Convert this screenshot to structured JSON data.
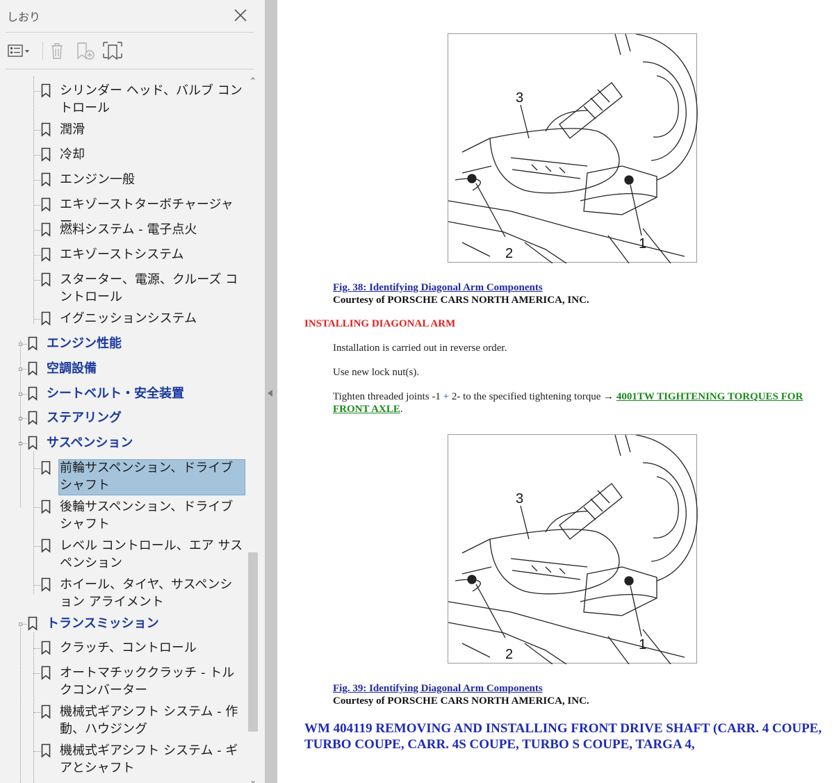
{
  "panel": {
    "title": "しおり",
    "toolbar": [
      "options-menu",
      "delete-bookmark",
      "new-bookmark",
      "bookmark-from-selection"
    ]
  },
  "bookmarks": [
    {
      "label": "シリンダー ヘッド、バルブ コントロール",
      "level": 2
    },
    {
      "label": "潤滑",
      "level": 2
    },
    {
      "label": "冷却",
      "level": 2
    },
    {
      "label": "エンジン一般",
      "level": 2
    },
    {
      "label": "エキゾーストターボチャージャー",
      "level": 2
    },
    {
      "label": "燃料システム - 電子点火",
      "level": 2
    },
    {
      "label": "エキゾーストシステム",
      "level": 2
    },
    {
      "label": "スターター、電源、クルーズ コントロール",
      "level": 2
    },
    {
      "label": "イグニッションシステム",
      "level": 2
    },
    {
      "label": "エンジン性能",
      "level": 1
    },
    {
      "label": "空調設備",
      "level": 1
    },
    {
      "label": "シートベルト・安全装置",
      "level": 1
    },
    {
      "label": "ステアリング",
      "level": 1
    },
    {
      "label": "サスペンション",
      "level": 1
    },
    {
      "label": "前輪サスペンション、ドライブ シャフト",
      "level": 2,
      "selected": true
    },
    {
      "label": "後輪サスペンション、ドライブ シャフト",
      "level": 2
    },
    {
      "label": "レベル コントロール、エア サスペンション",
      "level": 2
    },
    {
      "label": "ホイール、タイヤ、サスペンション アライメント",
      "level": 2
    },
    {
      "label": "トランスミッション",
      "level": 1
    },
    {
      "label": "クラッチ、コントロール",
      "level": 2
    },
    {
      "label": "オートマチッククラッチ - トルクコンバーター",
      "level": 2
    },
    {
      "label": "機械式ギアシフト システム - 作動、ハウジング",
      "level": 2
    },
    {
      "label": "機械式ギアシフト システム - ギアとシャフト",
      "level": 2
    }
  ],
  "document": {
    "figure_labels": [
      "3",
      "2",
      "1"
    ],
    "fig38_caption": "Fig. 38: Identifying Diagonal Arm Components",
    "fig38_courtesy": "Courtesy of PORSCHE CARS NORTH AMERICA, INC.",
    "section_heading": "INSTALLING DIAGONAL ARM",
    "para1": "Installation is carried out in reverse order.",
    "para2": "Use new lock nut(s).",
    "para3_prefix": "Tighten threaded joints -1 ",
    "para3_plus": "+",
    "para3_middle": " 2- to the specified tightening torque → ",
    "para3_link": "4001TW TIGHTENING TORQUES FOR FRONT AXLE",
    "para3_suffix": ".",
    "fig39_caption": "Fig. 39: Identifying Diagonal Arm Components",
    "fig39_courtesy": "Courtesy of PORSCHE CARS NORTH AMERICA, INC.",
    "wm_heading": "WM 404119 REMOVING AND INSTALLING FRONT DRIVE SHAFT (CARR. 4 COUPE, TURBO COUPE, CARR. 4S COUPE, TURBO S COUPE, TARGA 4,"
  },
  "colors": {
    "panel_bg": "#f2f2f2",
    "selection": "#a5c4dc",
    "level1_text": "#1b3aa0",
    "heading_red": "#e02020",
    "link_green": "#1a8a1a",
    "wm_blue": "#1f2ab8"
  }
}
